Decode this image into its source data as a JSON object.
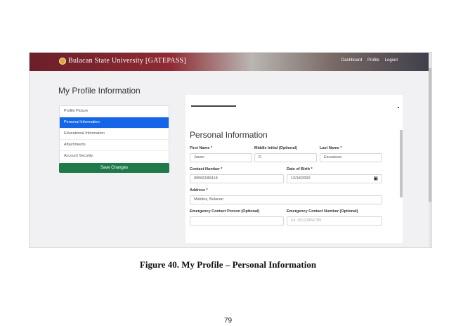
{
  "navbar": {
    "brand": "Bulacan State University [GATEPASS]",
    "links": [
      "Dashboard",
      "Profile",
      "Logout"
    ]
  },
  "page_title": "My Profile Information",
  "menu": {
    "items": [
      "Profile Picture",
      "Personal Information",
      "Educational Information",
      "Attachments",
      "Account Security"
    ],
    "active": "Personal Information"
  },
  "save_button": "Save Changes",
  "form": {
    "heading": "Personal Information",
    "first_name": {
      "label": "First Name *",
      "value": "Jason"
    },
    "middle_initial": {
      "label": "Middle Initial (Optional)",
      "value": "D"
    },
    "last_name": {
      "label": "Last Name *",
      "value": "Escasinas"
    },
    "contact_number": {
      "label": "Contact Number *",
      "value": "09566180418"
    },
    "date_of_birth": {
      "label": "Date of Birth *",
      "value": "12/18/2000"
    },
    "address": {
      "label": "Address *",
      "value": "Malolos, Bulacan"
    },
    "emergency_person": {
      "label": "Emergency Contact Person (Optional)",
      "value": ""
    },
    "emergency_number": {
      "label": "Emergency Contact Number (Optional)",
      "placeholder": "Ex. 09123456789"
    }
  },
  "caption": "Figure 40. My Profile – Personal Information",
  "page_number": "79",
  "colors": {
    "active_menu": "#1565e8",
    "save_button": "#1f7a4a",
    "navbar": "#8f2b33"
  },
  "icons": [
    "university-seal-icon",
    "calendar-icon"
  ]
}
